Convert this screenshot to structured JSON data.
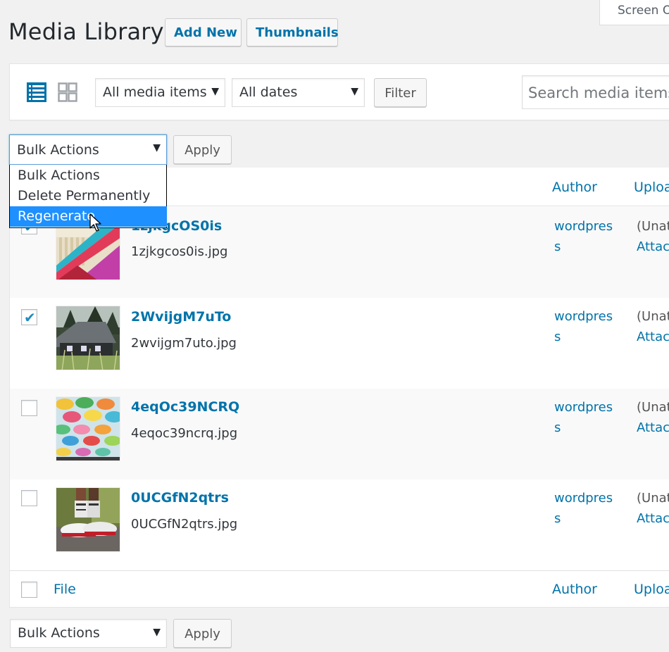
{
  "header": {
    "title": "Media Library",
    "add_new_label": "Add New",
    "thumbnails_label": "Thumbnails",
    "screen_options_label": "Screen Options"
  },
  "filters": {
    "view_modes": [
      {
        "icon": "list-view-icon",
        "active": true
      },
      {
        "icon": "grid-view-icon",
        "active": false
      }
    ],
    "media_type_selected": "All media items",
    "date_selected": "All dates",
    "filter_label": "Filter",
    "search_placeholder": "Search media items..."
  },
  "bulk_top": {
    "selected": "Bulk Actions",
    "apply_label": "Apply",
    "dropdown_open": true,
    "options": [
      {
        "label": "Bulk Actions",
        "highlighted": false
      },
      {
        "label": "Delete Permanently",
        "highlighted": false
      },
      {
        "label": "Regenerate",
        "highlighted": true
      }
    ]
  },
  "table": {
    "columns": {
      "file": "File",
      "author": "Author",
      "uploaded_to": "Uploaded to"
    },
    "rows": [
      {
        "title": "1zjkgcOS0is",
        "filename": "1zjkgcos0is.jpg",
        "author": "wordpress",
        "uploaded_to": "(Unattached)",
        "attach_label": "Attach",
        "checked": true
      },
      {
        "title": "2WvijgM7uTo",
        "filename": "2wvijgm7uto.jpg",
        "author": "wordpress",
        "uploaded_to": "(Unattached)",
        "attach_label": "Attach",
        "checked": true
      },
      {
        "title": "4eqOc39NCRQ",
        "filename": "4eqoc39ncrq.jpg",
        "author": "wordpress",
        "uploaded_to": "(Unattached)",
        "attach_label": "Attach",
        "checked": false
      },
      {
        "title": "0UCGfN2qtrs",
        "filename": "0UCGfN2qtrs.jpg",
        "author": "wordpress",
        "uploaded_to": "(Unattached)",
        "attach_label": "Attach",
        "checked": false
      }
    ]
  },
  "bulk_bottom": {
    "selected": "Bulk Actions",
    "apply_label": "Apply"
  },
  "colors": {
    "link": "#0073aa",
    "highlight": "#1e90ff",
    "background": "#f1f1f1"
  }
}
